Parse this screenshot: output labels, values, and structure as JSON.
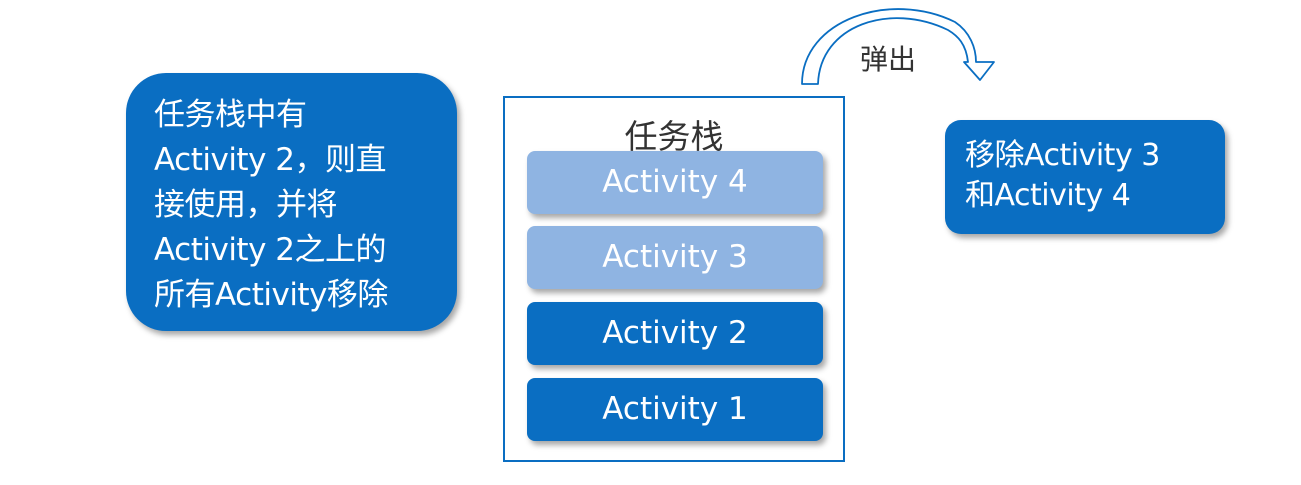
{
  "left_note": {
    "text": "任务栈中有\nActivity 2，则直\n接使用，并将\nActivity 2之上的\n所有Activity移除"
  },
  "stack": {
    "title": "任务栈",
    "items": [
      {
        "label": "Activity 4",
        "state": "removed"
      },
      {
        "label": "Activity 3",
        "state": "removed"
      },
      {
        "label": "Activity 2",
        "state": "kept"
      },
      {
        "label": "Activity 1",
        "state": "kept"
      }
    ]
  },
  "pop": {
    "label": "弹出"
  },
  "right_note": {
    "text": "移除Activity 3\n和Activity 4"
  },
  "colors": {
    "accent": "#0a6ec2",
    "removed": "#8fb4e2"
  }
}
